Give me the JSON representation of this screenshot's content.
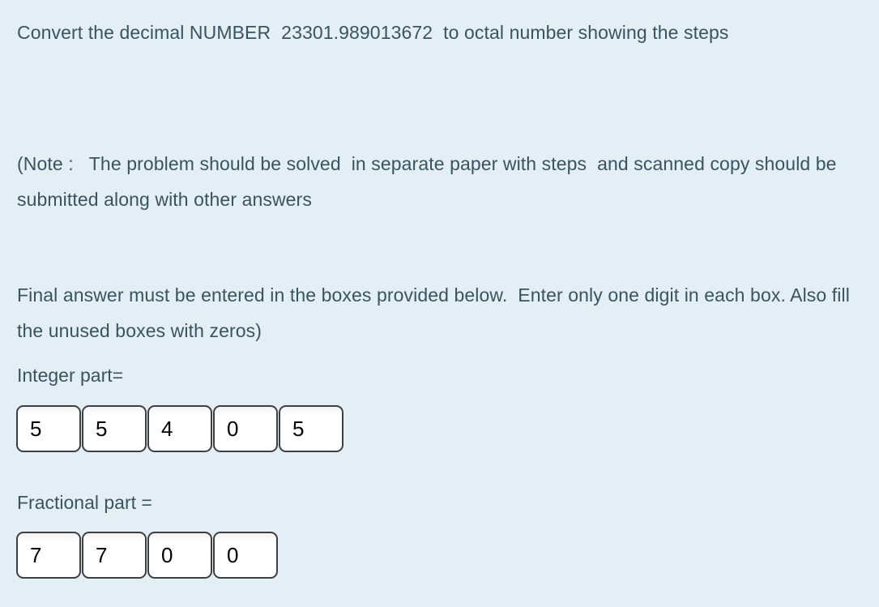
{
  "background_color": "#e4eef5",
  "text_color": "#3a545f",
  "question": {
    "prompt": "Convert the decimal NUMBER  23301.989013672  to octal number showing the steps",
    "decimal_number": "23301.989013672"
  },
  "note": {
    "text": "(Note :   The problem should be solved  in separate paper with steps  and scanned copy should be submitted along with other answers"
  },
  "instructions": {
    "text": "Final answer must be entered in the boxes provided below.  Enter only one digit in each box. Also fill the unused boxes with zeros)"
  },
  "integer_part": {
    "label": "Integer part=",
    "digits": [
      "5",
      "5",
      "4",
      "0",
      "5"
    ]
  },
  "fractional_part": {
    "label": "Fractional part =",
    "digits": [
      "7",
      "7",
      "0",
      "0"
    ]
  }
}
